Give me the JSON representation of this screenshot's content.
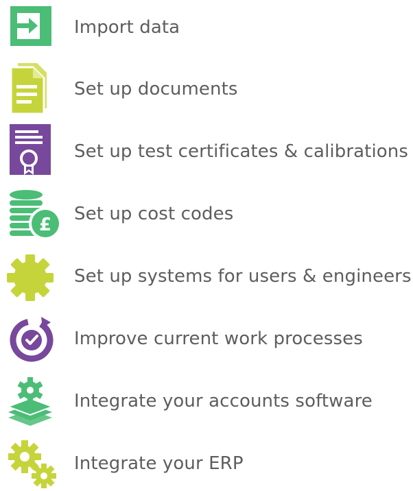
{
  "colors": {
    "green": "#4bbd76",
    "lime": "#c6d43b",
    "purple": "#77489b",
    "text": "#5d5d5d"
  },
  "items": [
    {
      "label": "Import data",
      "icon": "import-arrow-icon"
    },
    {
      "label": "Set up documents",
      "icon": "documents-icon"
    },
    {
      "label": "Set up test certificates & calibrations",
      "icon": "certificate-icon"
    },
    {
      "label": "Set up cost codes",
      "icon": "coins-pound-icon"
    },
    {
      "label": "Set up systems for users & engineers",
      "icon": "gear-icon"
    },
    {
      "label": "Improve current work processes",
      "icon": "refresh-check-icon"
    },
    {
      "label": "Integrate your accounts software",
      "icon": "layers-gear-icon"
    },
    {
      "label": "Integrate your ERP",
      "icon": "gears-icon"
    }
  ]
}
